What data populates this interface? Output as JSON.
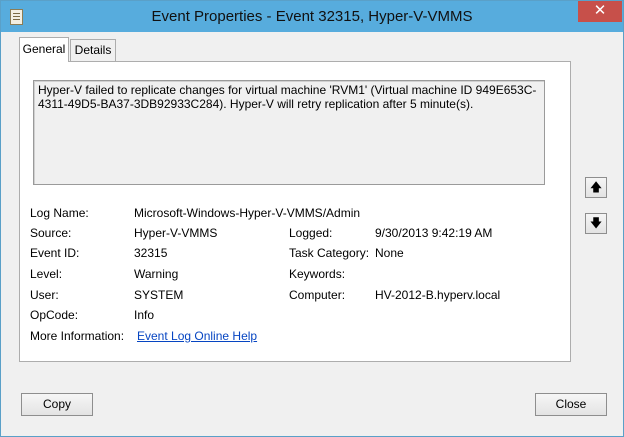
{
  "window": {
    "title": "Event Properties - Event 32315, Hyper-V-VMMS",
    "close_glyph": "✕"
  },
  "tabs": [
    {
      "label": "General",
      "active": true
    },
    {
      "label": "Details",
      "active": false
    }
  ],
  "description": "Hyper-V failed to replicate changes for virtual machine 'RVM1' (Virtual machine ID 949E653C-4311-49D5-BA37-3DB92933C284). Hyper-V will retry replication after 5 minute(s).",
  "fields": {
    "log_name": {
      "label": "Log Name:",
      "value": "Microsoft-Windows-Hyper-V-VMMS/Admin"
    },
    "source": {
      "label": "Source:",
      "value": "Hyper-V-VMMS"
    },
    "logged": {
      "label": "Logged:",
      "value": "9/30/2013 9:42:19 AM"
    },
    "event_id": {
      "label": "Event ID:",
      "value": "32315"
    },
    "task_category": {
      "label": "Task Category:",
      "value": "None"
    },
    "level": {
      "label": "Level:",
      "value": "Warning"
    },
    "keywords": {
      "label": "Keywords:",
      "value": ""
    },
    "user": {
      "label": "User:",
      "value": "SYSTEM"
    },
    "computer": {
      "label": "Computer:",
      "value": "HV-2012-B.hyperv.local"
    },
    "opcode": {
      "label": "OpCode:",
      "value": "Info"
    },
    "more_info": {
      "label": "More Information:",
      "link": "Event Log Online Help"
    }
  },
  "side_buttons": {
    "up_glyph": "🡅",
    "down_glyph": "🡇"
  },
  "buttons": {
    "copy": "Copy",
    "close": "Close"
  },
  "colors": {
    "titlebar": "#57acdd",
    "close": "#c7504a",
    "link": "#0645c2"
  }
}
